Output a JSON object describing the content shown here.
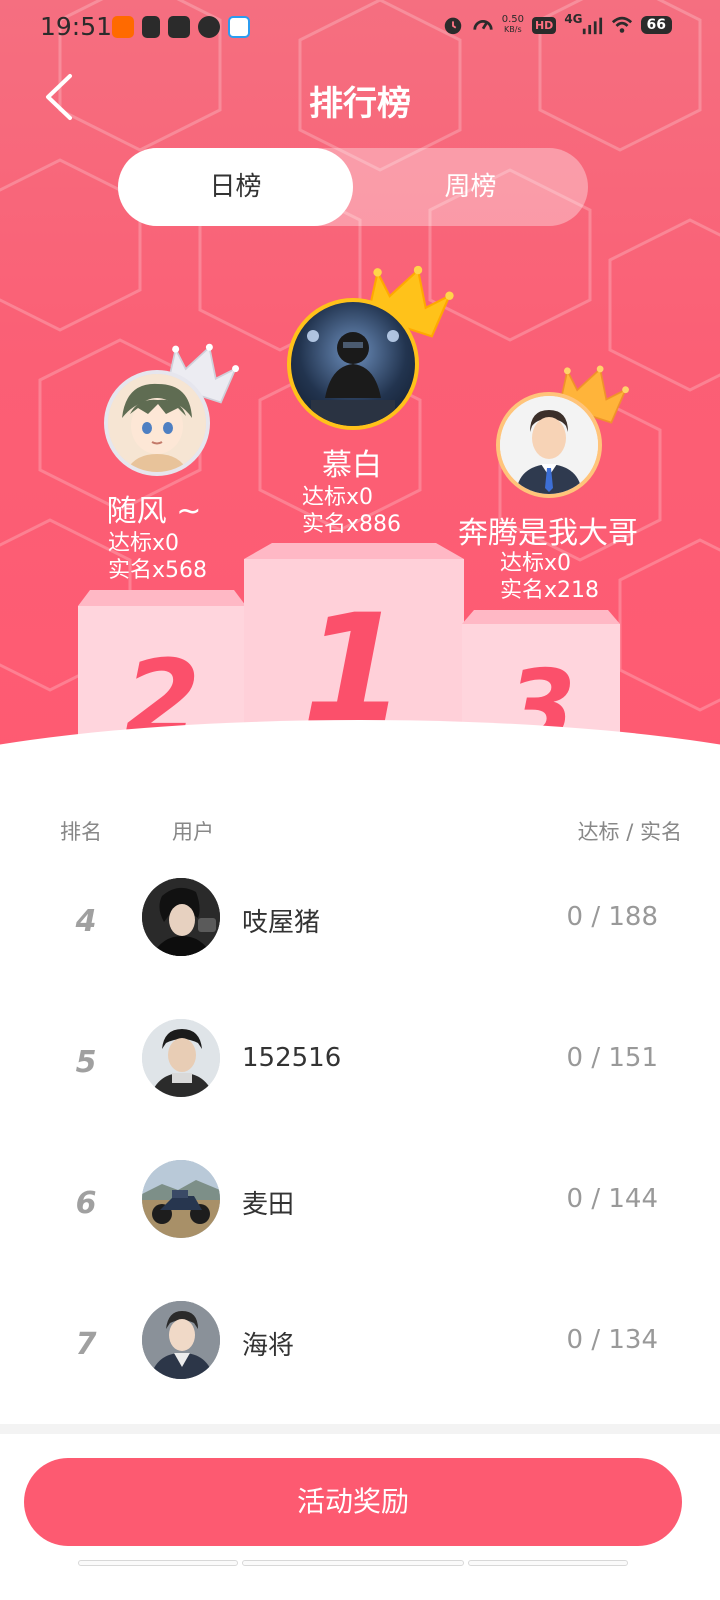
{
  "status_bar": {
    "time": "19:51",
    "net_speed_value": "0.50",
    "net_speed_unit": "KB/s",
    "hd": "HD",
    "network": "4G",
    "battery": "66"
  },
  "header": {
    "title": "排行榜",
    "back_icon": "chevron-left-icon"
  },
  "tabs": [
    {
      "label": "日榜",
      "active": true
    },
    {
      "label": "周榜",
      "active": false
    }
  ],
  "podium": {
    "first": {
      "rank_label": "1",
      "name": "慕白",
      "qualified": "达标x0",
      "verified": "实名x886"
    },
    "second": {
      "rank_label": "2",
      "name": "随风 ~",
      "qualified": "达标x0",
      "verified": "实名x568"
    },
    "third": {
      "rank_label": "3",
      "name": "奔腾是我大哥",
      "qualified": "达标x0",
      "verified": "实名x218"
    }
  },
  "list": {
    "headers": {
      "rank": "排名",
      "user": "用户",
      "score": "达标 / 实名"
    },
    "rows": [
      {
        "rank": "4",
        "name": "吱屋猪",
        "score": "0 / 188"
      },
      {
        "rank": "5",
        "name": "152516",
        "score": "0 / 151"
      },
      {
        "rank": "6",
        "name": "麦田",
        "score": "0 / 144"
      },
      {
        "rank": "7",
        "name": "海将",
        "score": "0 / 134"
      }
    ]
  },
  "footer": {
    "reward_button": "活动奖励"
  },
  "colors": {
    "accent": "#fd5a71",
    "hero_top": "#f56f80",
    "podium_face": "#ffd5dd",
    "rank_number": "#fb506b",
    "gold_crown": "#ffc21a",
    "silver_crown": "#e8e8ee"
  }
}
